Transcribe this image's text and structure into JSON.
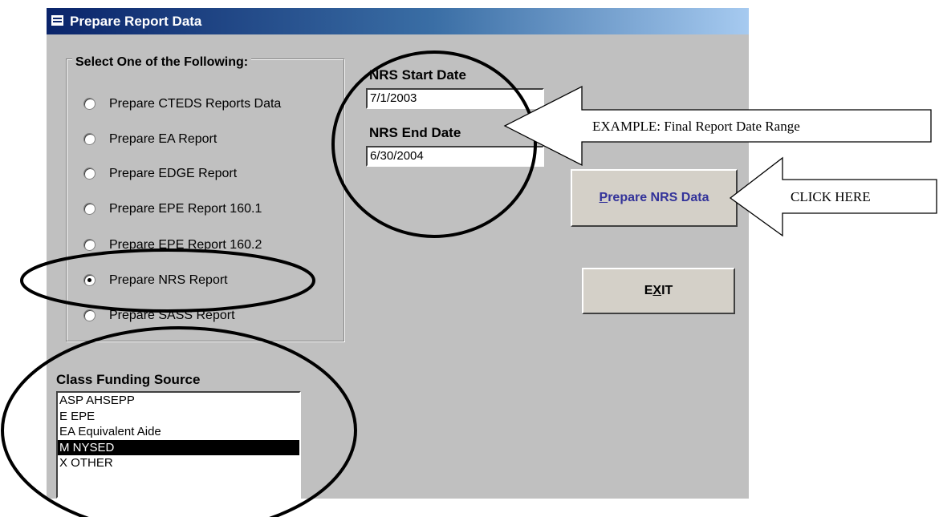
{
  "window": {
    "title": "Prepare Report Data"
  },
  "options": {
    "legend": "Select One of the Following:",
    "items": [
      {
        "label": "Prepare CTEDS Reports Data",
        "selected": false
      },
      {
        "label": "Prepare EA Report",
        "selected": false
      },
      {
        "label": "Prepare EDGE Report",
        "selected": false
      },
      {
        "label": "Prepare EPE Report 160.1",
        "selected": false
      },
      {
        "label": "Prepare EPE Report 160.2",
        "selected": false
      },
      {
        "label": "Prepare NRS Report",
        "selected": true
      },
      {
        "label": "Prepare SASS Report",
        "selected": false
      }
    ]
  },
  "dates": {
    "start_label": "NRS Start Date",
    "start_value": "7/1/2003",
    "end_label": "NRS End Date",
    "end_value": "6/30/2004"
  },
  "buttons": {
    "prepare_nrs": {
      "access_key": "P",
      "rest": "repare NRS Data"
    },
    "exit": {
      "before": "E",
      "access_key": "X",
      "after": "IT"
    }
  },
  "funding": {
    "label": "Class Funding Source",
    "items": [
      {
        "label": "ASP  AHSEPP",
        "selected": false
      },
      {
        "label": "E  EPE",
        "selected": false
      },
      {
        "label": "EA  Equivalent Aide",
        "selected": false
      },
      {
        "label": "M  NYSED",
        "selected": true
      },
      {
        "label": "X  OTHER",
        "selected": false
      }
    ]
  },
  "annotations": {
    "date_callout": "EXAMPLE: Final Report Date Range",
    "click_callout": "CLICK HERE"
  }
}
